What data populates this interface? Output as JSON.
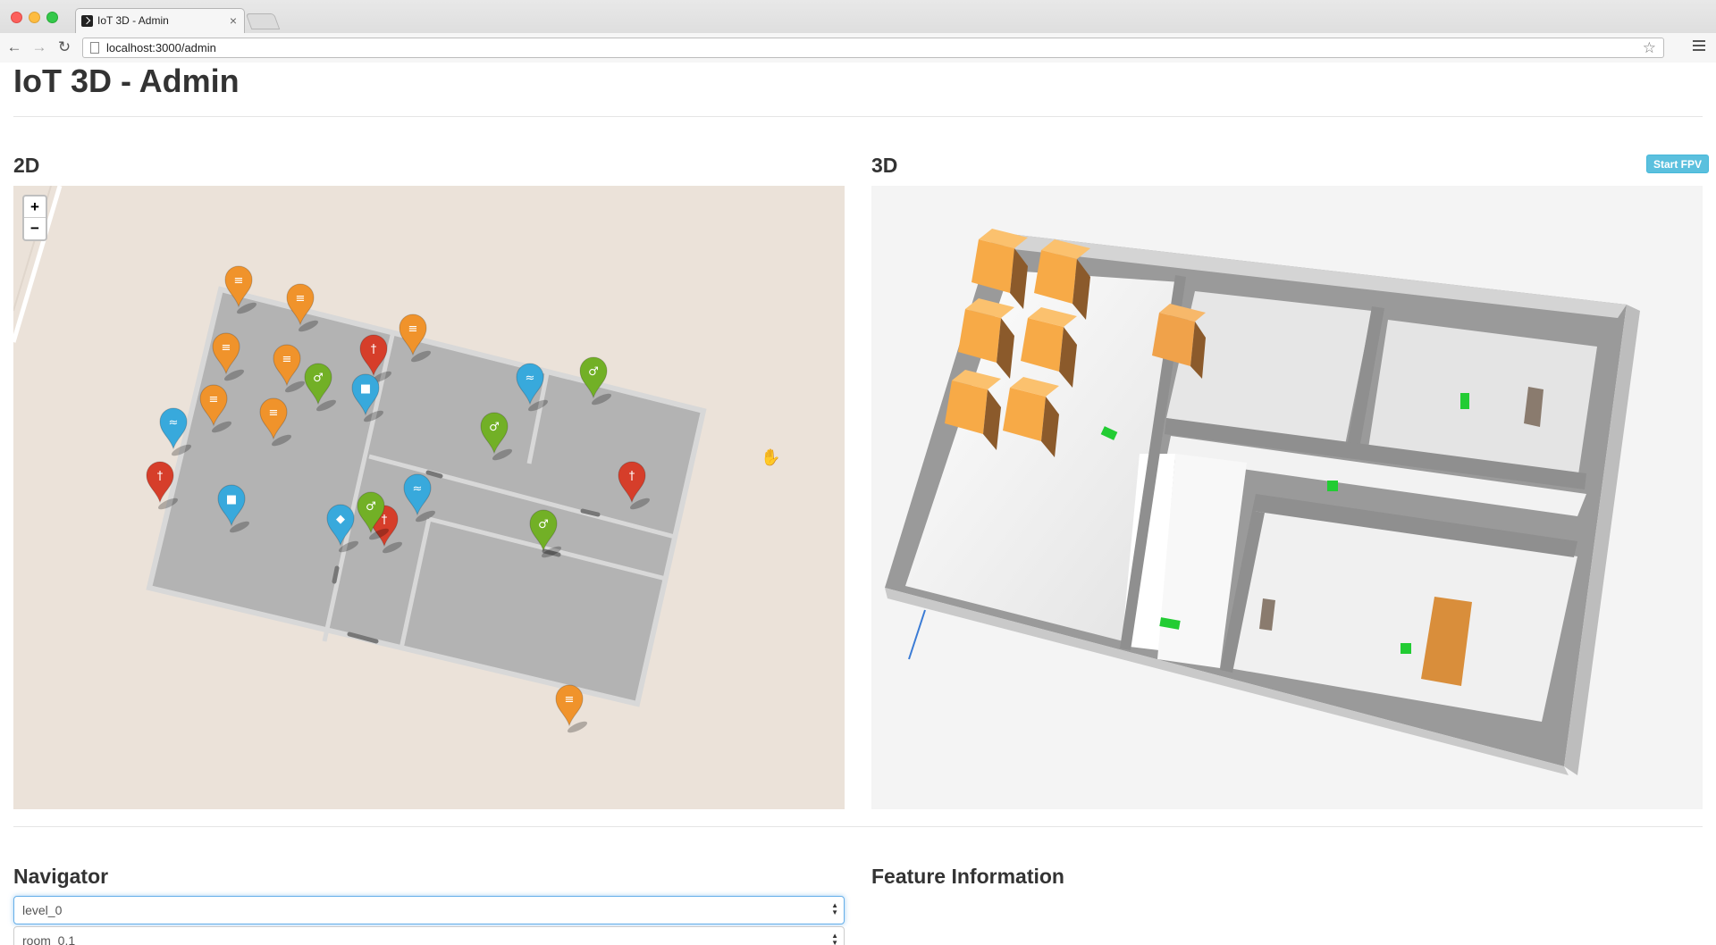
{
  "browser": {
    "tab_title": "IoT 3D - Admin",
    "tab_close": "×",
    "url": "localhost:3000/admin"
  },
  "page": {
    "title": "IoT 3D - Admin"
  },
  "panel_2d": {
    "title": "2D",
    "zoom_in": "+",
    "zoom_out": "−"
  },
  "panel_3d": {
    "title": "3D",
    "start_fpv_label": "Start FPV"
  },
  "navigator": {
    "title": "Navigator",
    "level_select": "level_0",
    "room_select": "room_0.1"
  },
  "feature_info": {
    "title": "Feature Information"
  },
  "colors": {
    "storage": "#f0932b",
    "extinguisher": "#d63e2a",
    "sensor": "#38a9dc",
    "person": "#72b026",
    "room_floor": "#b3b3b3",
    "accent": "#5bc0de"
  },
  "markers": [
    {
      "type": "storage",
      "icon": "database-icon"
    },
    {
      "type": "storage",
      "icon": "database-icon"
    },
    {
      "type": "storage",
      "icon": "database-icon"
    },
    {
      "type": "storage",
      "icon": "database-icon"
    },
    {
      "type": "storage",
      "icon": "database-icon"
    },
    {
      "type": "storage",
      "icon": "database-icon"
    },
    {
      "type": "storage",
      "icon": "database-icon"
    },
    {
      "type": "storage",
      "icon": "database-icon"
    },
    {
      "type": "extinguisher",
      "icon": "fire-extinguisher-icon"
    },
    {
      "type": "extinguisher",
      "icon": "fire-extinguisher-icon"
    },
    {
      "type": "extinguisher",
      "icon": "fire-extinguisher-icon"
    },
    {
      "type": "extinguisher",
      "icon": "fire-extinguisher-icon"
    },
    {
      "type": "sensor",
      "icon": "wifi-icon"
    },
    {
      "type": "sensor",
      "icon": "wifi-icon"
    },
    {
      "type": "sensor",
      "icon": "wifi-icon"
    },
    {
      "type": "sensor",
      "icon": "camera-icon"
    },
    {
      "type": "sensor",
      "icon": "camera-icon"
    },
    {
      "type": "sensor",
      "icon": "tag-icon"
    },
    {
      "type": "person",
      "icon": "person-icon"
    },
    {
      "type": "person",
      "icon": "person-icon"
    },
    {
      "type": "person",
      "icon": "person-icon"
    },
    {
      "type": "person",
      "icon": "person-icon"
    },
    {
      "type": "person",
      "icon": "person-icon"
    }
  ]
}
